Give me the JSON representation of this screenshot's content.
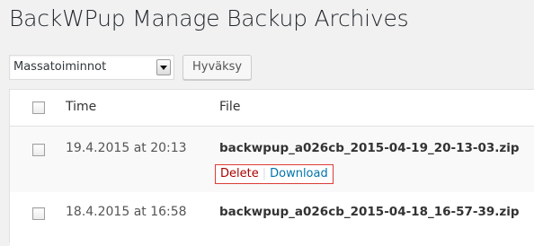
{
  "page": {
    "title": "BackWPup Manage Backup Archives"
  },
  "bulk_actions": {
    "selected": "Massatoiminnot",
    "apply_label": "Hyväksy"
  },
  "table": {
    "columns": [
      "Time",
      "File"
    ],
    "rows": [
      {
        "time": "19.4.2015 at 20:13",
        "file": "backwpup_a026cb_2015-04-19_20-13-03.zip",
        "actions": {
          "delete": "Delete",
          "separator": "|",
          "download": "Download"
        }
      },
      {
        "time": "18.4.2015 at 16:58",
        "file": "backwpup_a026cb_2015-04-18_16-57-39.zip"
      }
    ]
  },
  "colors": {
    "delete": "#aa0000",
    "download": "#0073aa",
    "highlight_border": "#dd3d36"
  }
}
